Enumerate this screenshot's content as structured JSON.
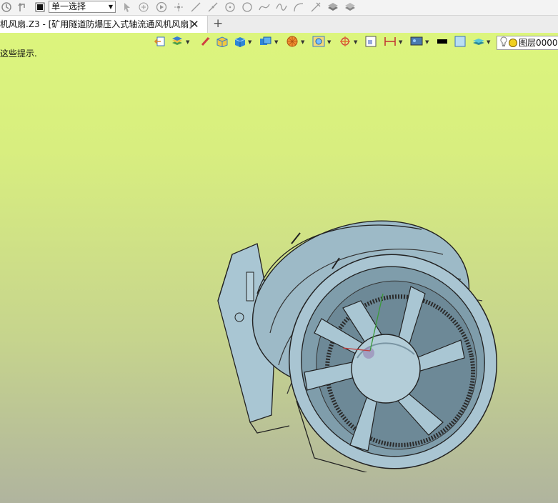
{
  "toolbar": {
    "select_mode": "单一选择",
    "icons": [
      "rebuild-icon",
      "undo-icon",
      "stop-icon",
      "pick-arrow-icon",
      "pick-filter-icon",
      "play-icon",
      "point-icon",
      "line-icon",
      "line-2-icon",
      "circle-center-icon",
      "circle-icon",
      "spline-icon",
      "curve-icon",
      "arc-icon",
      "trim-icon",
      "layer-stack-icon",
      "layer-stack-2-icon"
    ]
  },
  "tab": {
    "title": "机风扇.Z3 - [矿用隧道防爆压入式轴流通风机风扇]",
    "close_symbol": "✕",
    "new_symbol": "+"
  },
  "view": {
    "hint": "这些提示.",
    "layer_label": "图层0000",
    "colors": {
      "background_top": "#dcf57d",
      "background_bottom": "#b0b49e",
      "model": "#9dbac7"
    }
  }
}
